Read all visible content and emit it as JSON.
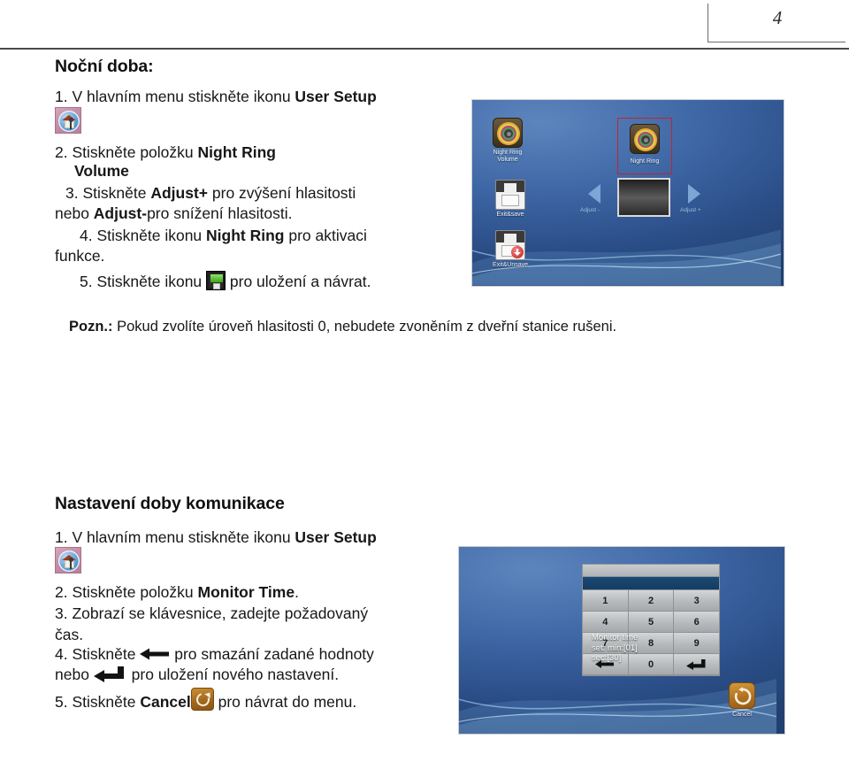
{
  "header": {
    "page_number": "4"
  },
  "section1": {
    "title": "Noční doba:",
    "steps": [
      {
        "num": "1.",
        "text_before": "V hlavním menu stiskněte ikonu ",
        "bold": "User Setup",
        "icon": "user-setup-icon"
      },
      {
        "num": "2.",
        "text_before": "Stiskněte   položku   ",
        "bold": "Night   Ring",
        "bold_line2": "Volume"
      },
      {
        "num": "3.",
        "text_before": "Stiskněte ",
        "bold": "Adjust+",
        "text_after": " pro zvýšení hlasitosti",
        "line2_before": "nebo  ",
        "line2_bold": "Adjust-",
        "line2_after": "pro snížení hlasitosti."
      },
      {
        "num": "4.",
        "text_before": "Stiskněte ikonu ",
        "bold": "Night Ring",
        "text_after": " pro aktivaci",
        "line2": "funkce."
      },
      {
        "num": "5.",
        "text_before": "Stiskněte ikonu ",
        "icon": "save-icon",
        "text_after": " pro uložení a návrat."
      }
    ],
    "note_label": "Pozn.:",
    "note_text": " Pokud zvolíte úroveň hlasitosti 0, nebudete zvoněním z dveřní stanice rušeni."
  },
  "section2": {
    "title": "Nastavení doby komunikace",
    "steps": [
      {
        "num": "1.",
        "text_before": "V hlavním menu stiskněte ikonu ",
        "bold": "User Setup",
        "icon": "user-setup-icon"
      },
      {
        "num": "2.",
        "text_before": "Stiskněte položku ",
        "bold": "Monitor Time",
        "text_after": "."
      },
      {
        "num": "3.",
        "text_before": "Zobrazí se klávesnice, zadejte požadovaný",
        "line2": "čas."
      },
      {
        "num": "4.",
        "text_before": "Stiskněte ",
        "icon": "backspace-arrow-icon",
        "text_after": " pro smazání zadané hodnoty",
        "line2_before": "nebo ",
        "line2_icon": "enter-arrow-icon",
        "line2_after": " pro uložení nového nastavení."
      },
      {
        "num": "5.",
        "text_before": "Stiskněte ",
        "bold": "Cancel",
        "icon": "cancel-icon",
        "text_after": " pro návrat do menu."
      }
    ]
  },
  "device_night_ring": {
    "items": [
      {
        "name": "night-ring-volume",
        "label": "Night Ring\nVolume",
        "icon": "target-ring-icon"
      },
      {
        "name": "night-ring",
        "label": "Night Ring",
        "icon": "target-ring-icon",
        "selected": true
      },
      {
        "name": "exit-and-save",
        "label": "Exit&save",
        "icon": "floppy-save-icon"
      },
      {
        "name": "exit-and-unsave",
        "label": "Exit&Unsave",
        "icon": "floppy-unsave-icon"
      }
    ],
    "adjust_minus_label": "Adjust -",
    "adjust_plus_label": "Adjust +",
    "selection_color": "#c2242f"
  },
  "device_monitor_time": {
    "keypad_rows": [
      [
        "1",
        "2",
        "3"
      ],
      [
        "4",
        "5",
        "6"
      ],
      [
        "7",
        "8",
        "9"
      ],
      [
        "backspace",
        "0",
        "enter"
      ]
    ],
    "overlay": "Monitor time\nset: min:[01]\nsec:[30]",
    "cancel_label": "Cancel",
    "monitor_min": "01",
    "monitor_sec": "30"
  }
}
